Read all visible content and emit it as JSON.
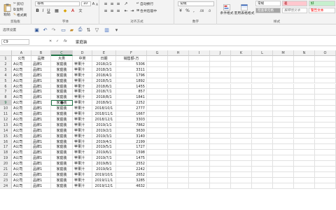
{
  "ribbon": {
    "clipboard": {
      "paste": "粘贴",
      "cut": "剪切",
      "copy": "复制",
      "format_painter": "格式刷",
      "label": "剪贴板"
    },
    "font": {
      "name": "等线",
      "size": "10",
      "label": "字体"
    },
    "align": {
      "wrap": "自动换行",
      "merge": "合并后居中",
      "label": "对齐方式"
    },
    "number": {
      "format": "常规",
      "label": "数字"
    },
    "styles": {
      "conditional": "条件格式",
      "table": "套用表格格式",
      "normal": "常规",
      "bad": "差",
      "good": "好",
      "check_cell": "检查单元格",
      "explanatory": "解释性文本",
      "warning": "警告文本",
      "label": "样式"
    },
    "colors": {
      "bad_bg": "#ffc7ce",
      "bad_fg": "#9c0006",
      "good_bg": "#c6efce",
      "good_fg": "#006100",
      "check_bg": "#a5a5a5",
      "accent": "#217346"
    }
  },
  "qat": {
    "label": "选项设置"
  },
  "formula_bar": {
    "cell_ref": "C9",
    "content": "家庭装"
  },
  "columns": [
    "A",
    "B",
    "C",
    "D",
    "E",
    "F",
    "G",
    "H",
    "I",
    "J",
    "K",
    "L",
    "M",
    "N",
    "O"
  ],
  "selected_column": "C",
  "selected_row": "9",
  "headers": [
    "公司",
    "品牌",
    "大类",
    "中类",
    "日期",
    "销售额-万"
  ],
  "rows": [
    {
      "n": "2",
      "a": "A公司",
      "b": "品牌1",
      "c": "家庭装",
      "d": "苹果汁",
      "e": "2018/2/1",
      "f": "5306"
    },
    {
      "n": "3",
      "a": "A公司",
      "b": "品牌1",
      "c": "家庭装",
      "d": "苹果汁",
      "e": "2018/3/1",
      "f": "3311"
    },
    {
      "n": "4",
      "a": "A公司",
      "b": "品牌1",
      "c": "家庭装",
      "d": "苹果汁",
      "e": "2018/4/1",
      "f": "1796"
    },
    {
      "n": "5",
      "a": "A公司",
      "b": "品牌1",
      "c": "家庭装",
      "d": "苹果汁",
      "e": "2018/5/1",
      "f": "1892"
    },
    {
      "n": "6",
      "a": "A公司",
      "b": "品牌1",
      "c": "家庭装",
      "d": "苹果汁",
      "e": "2018/6/1",
      "f": "1455"
    },
    {
      "n": "7",
      "a": "A公司",
      "b": "品牌1",
      "c": "家庭装",
      "d": "苹果汁",
      "e": "2018/7/1",
      "f": "857"
    },
    {
      "n": "8",
      "a": "A公司",
      "b": "品牌1",
      "c": "家庭装",
      "d": "苹果汁",
      "e": "2018/8/1",
      "f": "1841"
    },
    {
      "n": "9",
      "a": "A公司",
      "b": "品牌1",
      "c": "家庭装",
      "d": "苹果汁",
      "e": "2018/9/1",
      "f": "2252"
    },
    {
      "n": "10",
      "a": "A公司",
      "b": "品牌1",
      "c": "家庭装",
      "d": "苹果汁",
      "e": "2018/10/1",
      "f": "2777"
    },
    {
      "n": "11",
      "a": "A公司",
      "b": "品牌1",
      "c": "家庭装",
      "d": "苹果汁",
      "e": "2018/11/1",
      "f": "1667"
    },
    {
      "n": "12",
      "a": "A公司",
      "b": "品牌1",
      "c": "家庭装",
      "d": "苹果汁",
      "e": "2018/12/1",
      "f": "3303"
    },
    {
      "n": "13",
      "a": "A公司",
      "b": "品牌1",
      "c": "家庭装",
      "d": "苹果汁",
      "e": "2019/1/1",
      "f": "7862"
    },
    {
      "n": "14",
      "a": "A公司",
      "b": "品牌1",
      "c": "家庭装",
      "d": "苹果汁",
      "e": "2019/2/1",
      "f": "3630"
    },
    {
      "n": "15",
      "a": "A公司",
      "b": "品牌1",
      "c": "家庭装",
      "d": "苹果汁",
      "e": "2019/3/1",
      "f": "3140"
    },
    {
      "n": "16",
      "a": "A公司",
      "b": "品牌1",
      "c": "家庭装",
      "d": "苹果汁",
      "e": "2019/4/1",
      "f": "2199"
    },
    {
      "n": "17",
      "a": "A公司",
      "b": "品牌1",
      "c": "家庭装",
      "d": "苹果汁",
      "e": "2019/5/1",
      "f": "1727"
    },
    {
      "n": "18",
      "a": "A公司",
      "b": "品牌1",
      "c": "家庭装",
      "d": "苹果汁",
      "e": "2019/6/1",
      "f": "1598"
    },
    {
      "n": "19",
      "a": "A公司",
      "b": "品牌1",
      "c": "家庭装",
      "d": "苹果汁",
      "e": "2019/7/1",
      "f": "1475"
    },
    {
      "n": "20",
      "a": "A公司",
      "b": "品牌1",
      "c": "家庭装",
      "d": "苹果汁",
      "e": "2019/8/1",
      "f": "2552"
    },
    {
      "n": "21",
      "a": "A公司",
      "b": "品牌1",
      "c": "家庭装",
      "d": "苹果汁",
      "e": "2019/9/1",
      "f": "2242"
    },
    {
      "n": "22",
      "a": "A公司",
      "b": "品牌1",
      "c": "家庭装",
      "d": "苹果汁",
      "e": "2019/10/1",
      "f": "2652"
    },
    {
      "n": "23",
      "a": "A公司",
      "b": "品牌1",
      "c": "家庭装",
      "d": "苹果汁",
      "e": "2019/11/1",
      "f": "3285"
    },
    {
      "n": "24",
      "a": "A公司",
      "b": "品牌1",
      "c": "家庭装",
      "d": "苹果汁",
      "e": "2019/12/1",
      "f": "4632"
    }
  ]
}
